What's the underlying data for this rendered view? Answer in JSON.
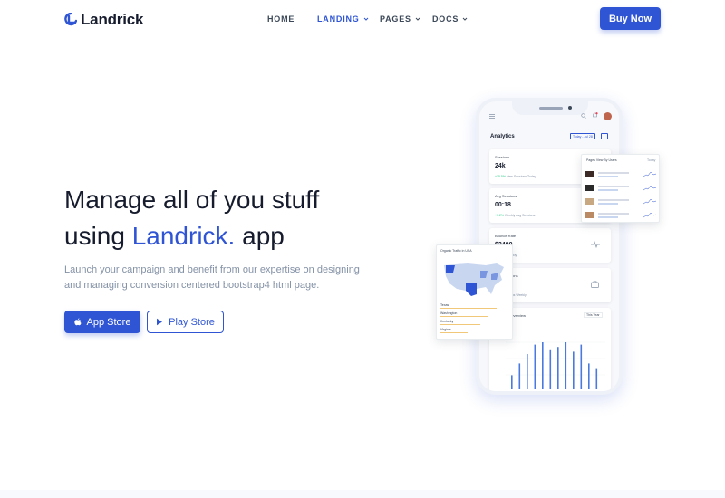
{
  "brand": {
    "name": "Landrick"
  },
  "nav": {
    "items": [
      {
        "label": "HOME",
        "active": false,
        "dropdown": false
      },
      {
        "label": "LANDING",
        "active": true,
        "dropdown": true
      },
      {
        "label": "PAGES",
        "active": false,
        "dropdown": true
      },
      {
        "label": "DOCS",
        "active": false,
        "dropdown": true
      }
    ],
    "cta": "Buy Now"
  },
  "hero": {
    "title_line1": "Manage all of you stuff",
    "title_line2_prefix": "using ",
    "title_highlight": "Landrick.",
    "title_line2_suffix": " app",
    "subtitle": "Launch your campaign and benefit from our expertise on designing and managing conversion centered bootstrap4 html page.",
    "buttons": {
      "app_store": "App Store",
      "play_store": "Play Store"
    }
  },
  "phone": {
    "title": "Analytics",
    "date_range": "Today - Jul 28",
    "cards": [
      {
        "label": "Sessions",
        "value": "24k",
        "delta": "+15.5%",
        "note": " New Sessions Today"
      },
      {
        "label": "Avg Sessions",
        "value": "00:18",
        "delta": "+1.2%",
        "note": " Weekly Avg Sessions"
      },
      {
        "label": "Bounce Rate",
        "value": "$2400",
        "delta": "",
        "note": "Bounce Weekly"
      },
      {
        "label": "Conversations",
        "value": "",
        "delta": "",
        "note": "Conversations Weekly"
      }
    ],
    "chart_label": "Sessions Overview",
    "chart_filter": "This Year",
    "bars": [
      0.3,
      0.55,
      0.75,
      0.95,
      1.0,
      0.85,
      0.9,
      1.0,
      0.8,
      0.95,
      0.55,
      0.45
    ]
  },
  "float_card_right": {
    "title": "Pages View By Users",
    "filter": "Today"
  },
  "float_card_left": {
    "title": "Organic Traffic in USA",
    "states": [
      "Texas",
      "Washington",
      "Kentucky",
      "Virginia"
    ]
  },
  "colors": {
    "primary": "#2f55d4",
    "text": "#161c2d",
    "muted": "#8492a6"
  }
}
